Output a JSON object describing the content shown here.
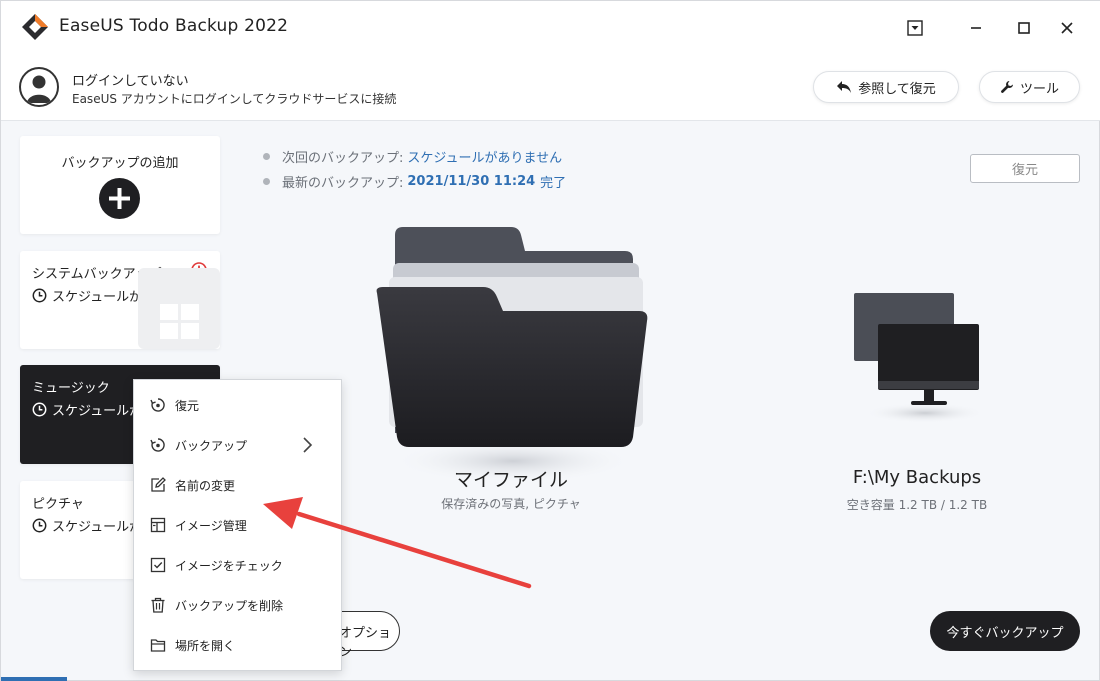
{
  "titlebar": {
    "title": "EaseUS Todo Backup 2022"
  },
  "account": {
    "title": "ログインしていない",
    "subtitle": "EaseUS アカウントにログインしてクラウドサービスに接続",
    "browse_restore_label": "参照して復元",
    "tools_label": "ツール"
  },
  "sidebar": {
    "add_backup_label": "バックアップの追加",
    "cards": [
      {
        "title": "システムバックアップ",
        "schedule": "スケジュールがありません"
      },
      {
        "title": "ミュージック",
        "schedule": "スケジュールがありません"
      },
      {
        "title": "ピクチャ",
        "schedule": "スケジュールがありません"
      }
    ]
  },
  "main": {
    "next_backup_label": "次回のバックアップ:",
    "next_backup_value": "スケジュールがありません",
    "latest_backup_label": "最新のバックアップ:",
    "latest_backup_value": "2021/11/30 11:24",
    "latest_backup_status": "完了",
    "restore_label": "復元",
    "source_title": "マイファイル",
    "source_sub": "保存済みの写真, ピクチャ",
    "destination_title": "F:\\My Backups",
    "destination_sub": "空き容量 1.2 TB / 1.2 TB",
    "options_label": "オプション",
    "backup_now_label": "今すぐバックアップ"
  },
  "context_menu": {
    "items": [
      {
        "label": "復元",
        "icon": "restore-icon"
      },
      {
        "label": "バックアップ",
        "icon": "backup-icon",
        "has_submenu": true
      },
      {
        "label": "名前の変更",
        "icon": "rename-icon"
      },
      {
        "label": "イメージ管理",
        "icon": "image-manage-icon"
      },
      {
        "label": "イメージをチェック",
        "icon": "check-icon"
      },
      {
        "label": "バックアップを削除",
        "icon": "delete-icon"
      },
      {
        "label": "場所を開く",
        "icon": "folder-icon"
      }
    ]
  },
  "colors": {
    "accent_blue": "#2f6fb3",
    "dark": "#1f1f22",
    "error_red": "#e03a3a",
    "annotation_red": "#e8413d"
  }
}
